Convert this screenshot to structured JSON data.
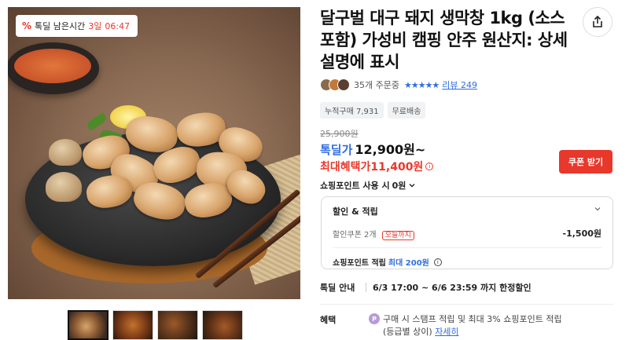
{
  "gallery": {
    "timer": {
      "label": "톡딜 남은시간",
      "days": "3일",
      "time": "06:47"
    },
    "thumbnails": [
      "thumb-1",
      "thumb-2",
      "thumb-3",
      "thumb-4"
    ],
    "active_thumbnail": 0
  },
  "product": {
    "title": "달구벌 대구 돼지 생막창 1kg (소스포함) 가성비 캠핑 안주 원산지: 상세설명에 표시",
    "order_count": "35개 주문중",
    "stars": "★★★★★",
    "review_link": "리뷰 249",
    "tags": [
      "누적구매 7,931",
      "무료배송"
    ]
  },
  "price": {
    "original": "25,900원",
    "deal_label": "톡딜가",
    "deal_price": "12,900원~",
    "max_label": "최대혜택가",
    "max_price": "11,400원",
    "coupon_button": "쿠폰 받기",
    "shopping_points": "쇼핑포인트 사용 시",
    "shopping_points_value": "0원"
  },
  "benefit_box": {
    "title": "할인 & 적립",
    "coupon_line": "할인쿠폰 2개",
    "today_badge": "오늘까지",
    "coupon_amount": "-1,500원",
    "point_label": "쇼핑포인트 적립",
    "point_max": "최대 200원"
  },
  "deal_info": {
    "label": "톡딜 안내",
    "value": "6/3 17:00 ~ 6/6 23:59 까지 한정할인"
  },
  "benefit": {
    "label": "혜택",
    "p_icon": "P",
    "line1": "구매 시 스탬프 적립 및 최대 3% 쇼핑포인트 적립",
    "line2_prefix": "(등급별 상이)",
    "line2_link": "자세히"
  },
  "colors": {
    "accent_red": "#e8382b",
    "accent_blue": "#2f6ee0"
  }
}
